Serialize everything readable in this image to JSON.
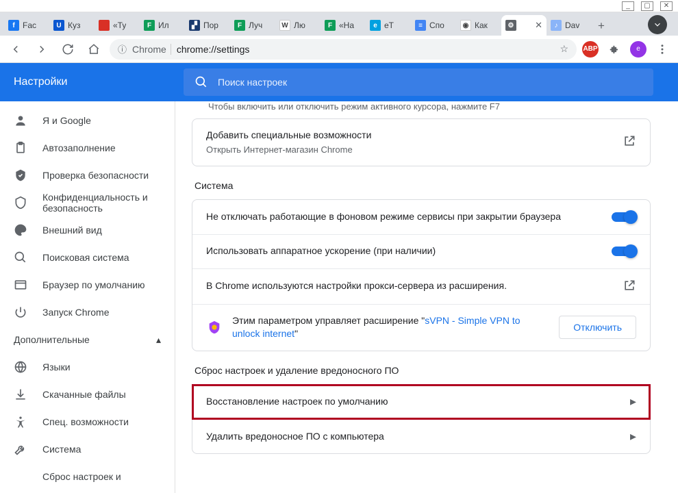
{
  "window": {
    "minimize": "_",
    "maximize": "▢",
    "close": "✕"
  },
  "tabs": [
    {
      "title": "Fac",
      "fav_bg": "#1877f2",
      "fav_label": "f"
    },
    {
      "title": "Куз",
      "fav_bg": "#0b57d0",
      "fav_label": "U"
    },
    {
      "title": "«Ту",
      "fav_bg": "#d93025",
      "fav_label": ""
    },
    {
      "title": "Ил",
      "fav_bg": "#0f9d58",
      "fav_label": "F"
    },
    {
      "title": "Пор",
      "fav_bg": "#1a3a6e",
      "fav_label": "▞"
    },
    {
      "title": "Луч",
      "fav_bg": "#0f9d58",
      "fav_label": "F"
    },
    {
      "title": "Лю",
      "fav_bg": "#ffffff",
      "fav_label": "W"
    },
    {
      "title": "«На",
      "fav_bg": "#0f9d58",
      "fav_label": "F"
    },
    {
      "title": "eТ",
      "fav_bg": "#00a1e0",
      "fav_label": "e"
    },
    {
      "title": "Спо",
      "fav_bg": "#4285f4",
      "fav_label": "≡"
    },
    {
      "title": "Как",
      "fav_bg": "#ffffff",
      "fav_label": "◉"
    },
    {
      "title": "",
      "fav_bg": "#5f6368",
      "fav_label": "⚙",
      "active": true
    },
    {
      "title": "Dav",
      "fav_bg": "#8ab4f8",
      "fav_label": "♪"
    }
  ],
  "toolbar": {
    "chrome_label": "Chrome",
    "url": "chrome://settings",
    "abp": "ABP",
    "profile_initial": "e"
  },
  "header": {
    "title": "Настройки",
    "search_placeholder": "Поиск настроек"
  },
  "sidebar": {
    "items": [
      {
        "label": "Я и Google",
        "icon": "person"
      },
      {
        "label": "Автозаполнение",
        "icon": "clipboard"
      },
      {
        "label": "Проверка безопасности",
        "icon": "shield-check"
      },
      {
        "label": "Конфиденциальность и безопасность",
        "icon": "shield"
      },
      {
        "label": "Внешний вид",
        "icon": "palette"
      },
      {
        "label": "Поисковая система",
        "icon": "search"
      },
      {
        "label": "Браузер по умолчанию",
        "icon": "browser"
      },
      {
        "label": "Запуск Chrome",
        "icon": "power"
      }
    ],
    "advanced_label": "Дополнительные",
    "advanced_items": [
      {
        "label": "Языки",
        "icon": "globe"
      },
      {
        "label": "Скачанные файлы",
        "icon": "download"
      },
      {
        "label": "Спец. возможности",
        "icon": "accessibility"
      },
      {
        "label": "Система",
        "icon": "wrench"
      },
      {
        "label": "Сброс настроек и",
        "icon": ""
      }
    ]
  },
  "main": {
    "cut_caret": "Чтобы включить или отключить режим активного курсора, нажмите F7",
    "a11y_add_title": "Добавить специальные возможности",
    "a11y_add_sub": "Открыть Интернет-магазин Chrome",
    "system_title": "Система",
    "system_row1": "Не отключать работающие в фоновом режиме сервисы при закрытии браузера",
    "system_row2": "Использовать аппаратное ускорение (при наличии)",
    "proxy_row": "В Chrome используются настройки прокси-сервера из расширения.",
    "vpn_prefix": "Этим параметром управляет расширение \"",
    "vpn_link": "sVPN - Simple VPN to unlock internet",
    "vpn_suffix": "\"",
    "disable_btn": "Отключить",
    "reset_title": "Сброс настроек и удаление вредоносного ПО",
    "reset_row1": "Восстановление настроек по умолчанию",
    "reset_row2": "Удалить вредоносное ПО с компьютера"
  }
}
